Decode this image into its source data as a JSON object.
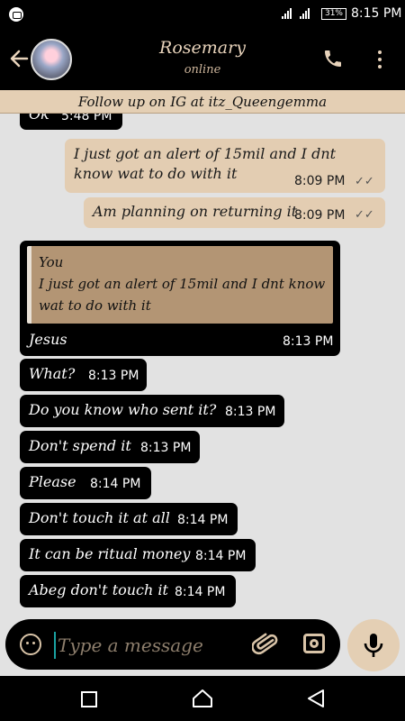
{
  "status_bar": {
    "battery": "31%",
    "time": "8:15 PM"
  },
  "header": {
    "contact_name": "Rosemary",
    "status": "online"
  },
  "banner": {
    "text": "Follow up on IG at itz_Queengemma"
  },
  "messages": [
    {
      "dir": "in",
      "text": "Ok",
      "time": "5:48 PM"
    },
    {
      "dir": "out",
      "text": "I just got an alert of 15mil and I dnt know wat to do with it",
      "time": "8:09 PM"
    },
    {
      "dir": "out",
      "text": "Am planning on returning it",
      "time": "8:09 PM"
    },
    {
      "dir": "in",
      "quote_author": "You",
      "quote_text": "I just got an alert of 15mil and I dnt know wat to do with it",
      "text": "Jesus",
      "time": "8:13 PM"
    },
    {
      "dir": "in",
      "text": "What?",
      "time": "8:13 PM"
    },
    {
      "dir": "in",
      "text": "Do you know who sent it?",
      "time": "8:13 PM"
    },
    {
      "dir": "in",
      "text": "Don't spend it",
      "time": "8:13 PM"
    },
    {
      "dir": "in",
      "text": "Please",
      "time": "8:14 PM"
    },
    {
      "dir": "in",
      "text": "Don't touch it at all",
      "time": "8:14 PM"
    },
    {
      "dir": "in",
      "text": "It can be ritual money",
      "time": "8:14 PM"
    },
    {
      "dir": "in",
      "text": "Abeg don't touch it",
      "time": "8:14 PM"
    }
  ],
  "input": {
    "placeholder": "Type a message"
  },
  "colors": {
    "incoming": "#000000",
    "outgoing": "#e3cdb2",
    "accent": "#e8d3bb",
    "background": "#e2e2e2"
  },
  "icons": [
    "back-arrow-icon",
    "call-icon",
    "more-vert-icon",
    "emoji-icon",
    "attach-icon",
    "camera-icon",
    "mic-icon",
    "double-check-icon"
  ]
}
